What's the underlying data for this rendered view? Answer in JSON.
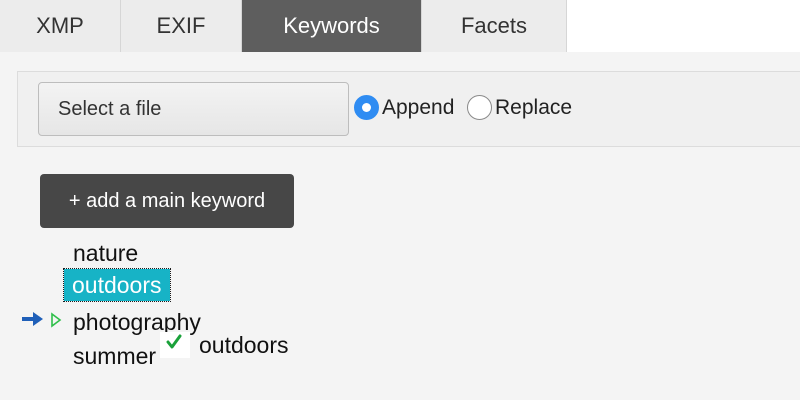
{
  "tabs": [
    {
      "label": "XMP",
      "active": false
    },
    {
      "label": "EXIF",
      "active": false
    },
    {
      "label": "Keywords",
      "active": true
    },
    {
      "label": "Facets",
      "active": false
    }
  ],
  "toolbar": {
    "file_button_label": "Select a file",
    "mode_options": [
      {
        "label": "Append",
        "selected": true
      },
      {
        "label": "Replace",
        "selected": false
      }
    ]
  },
  "add_keyword_button_label": "+ add a main keyword",
  "keywords": [
    {
      "label": "nature",
      "selected": false
    },
    {
      "label": "outdoors",
      "selected": true
    },
    {
      "label": "photography",
      "selected": false
    },
    {
      "label": "summer",
      "selected": false
    }
  ],
  "drag_preview": {
    "label": "outdoors",
    "icon": "check-icon"
  },
  "colors": {
    "active_tab": "#5e5e5e",
    "selected_keyword": "#17b3c6",
    "radio_accent": "#2f8cf2",
    "add_button": "#474747",
    "check": "#1aa13a",
    "arrow": "#1f5fb8"
  }
}
